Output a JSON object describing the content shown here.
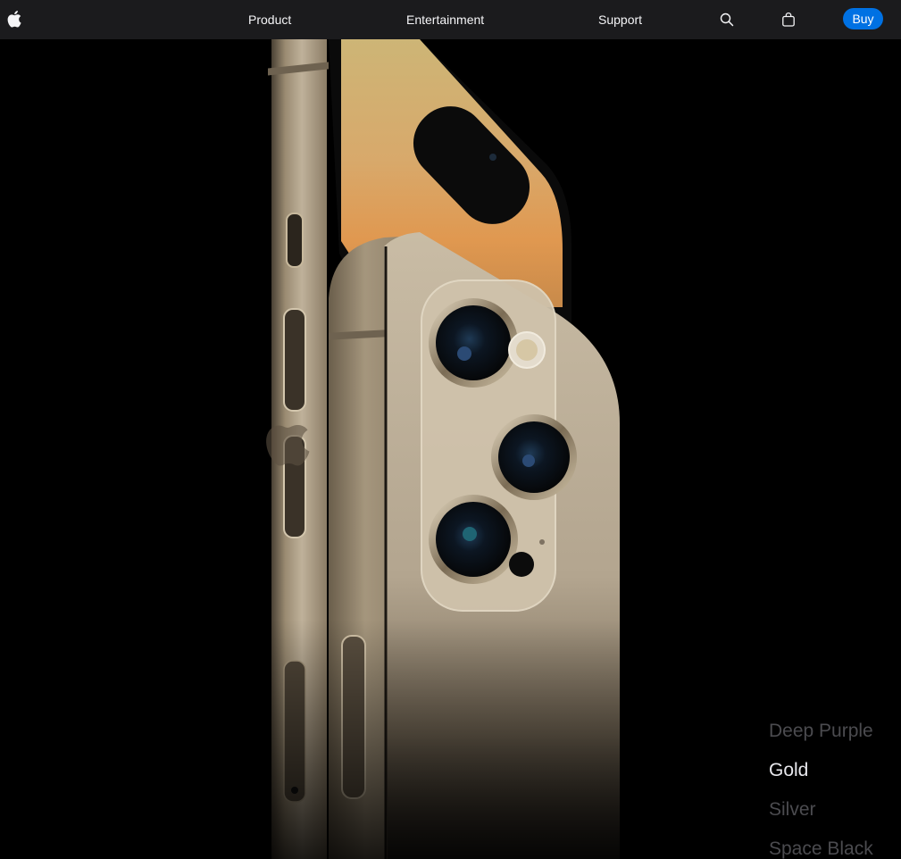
{
  "nav": {
    "logo_icon": "apple-logo-icon",
    "links": [
      "Product",
      "Entertainment",
      "Support"
    ],
    "search_icon": "search-icon",
    "bag_icon": "bag-icon",
    "buy_label": "Buy"
  },
  "colors": {
    "options": [
      "Deep Purple",
      "Gold",
      "Silver",
      "Space Black"
    ],
    "selected": "Gold",
    "accent": "#0071e3",
    "selected_text": "#e8e8ed",
    "dim_text": "#4b4b4f"
  }
}
